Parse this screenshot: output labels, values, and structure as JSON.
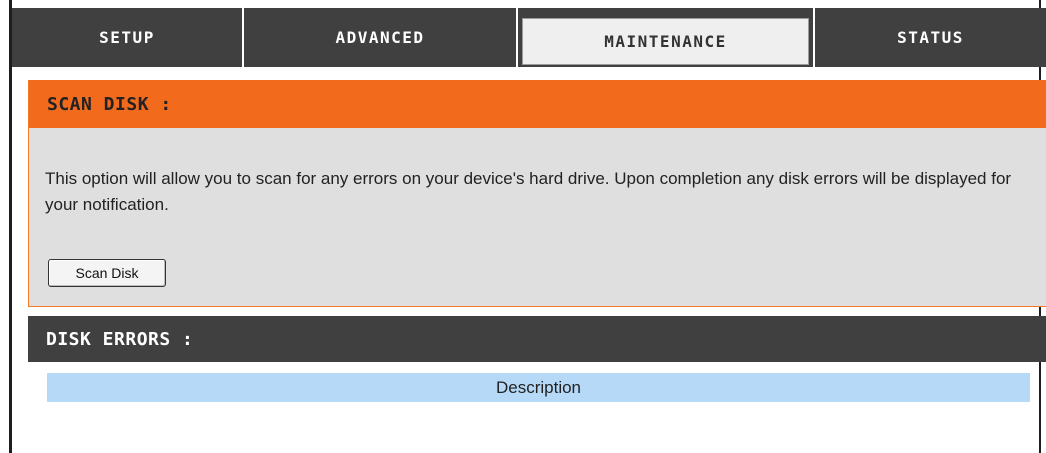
{
  "nav": {
    "tabs": [
      {
        "label": "SETUP",
        "active": false
      },
      {
        "label": "ADVANCED",
        "active": false
      },
      {
        "label": "MAINTENANCE",
        "active": true
      },
      {
        "label": "STATUS",
        "active": false
      }
    ]
  },
  "scan_disk": {
    "title": "SCAN DISK :",
    "description": "This option will allow you to scan for any errors on your device's hard drive. Upon completion any disk errors will be displayed for your notification.",
    "button_label": "Scan Disk"
  },
  "disk_errors": {
    "title": "DISK ERRORS :",
    "columns": [
      "Description"
    ]
  },
  "colors": {
    "accent_orange": "#f26b1d",
    "nav_dark": "#404040",
    "panel_gray": "#dfdfdf",
    "table_header_blue": "#b6d9f7"
  }
}
